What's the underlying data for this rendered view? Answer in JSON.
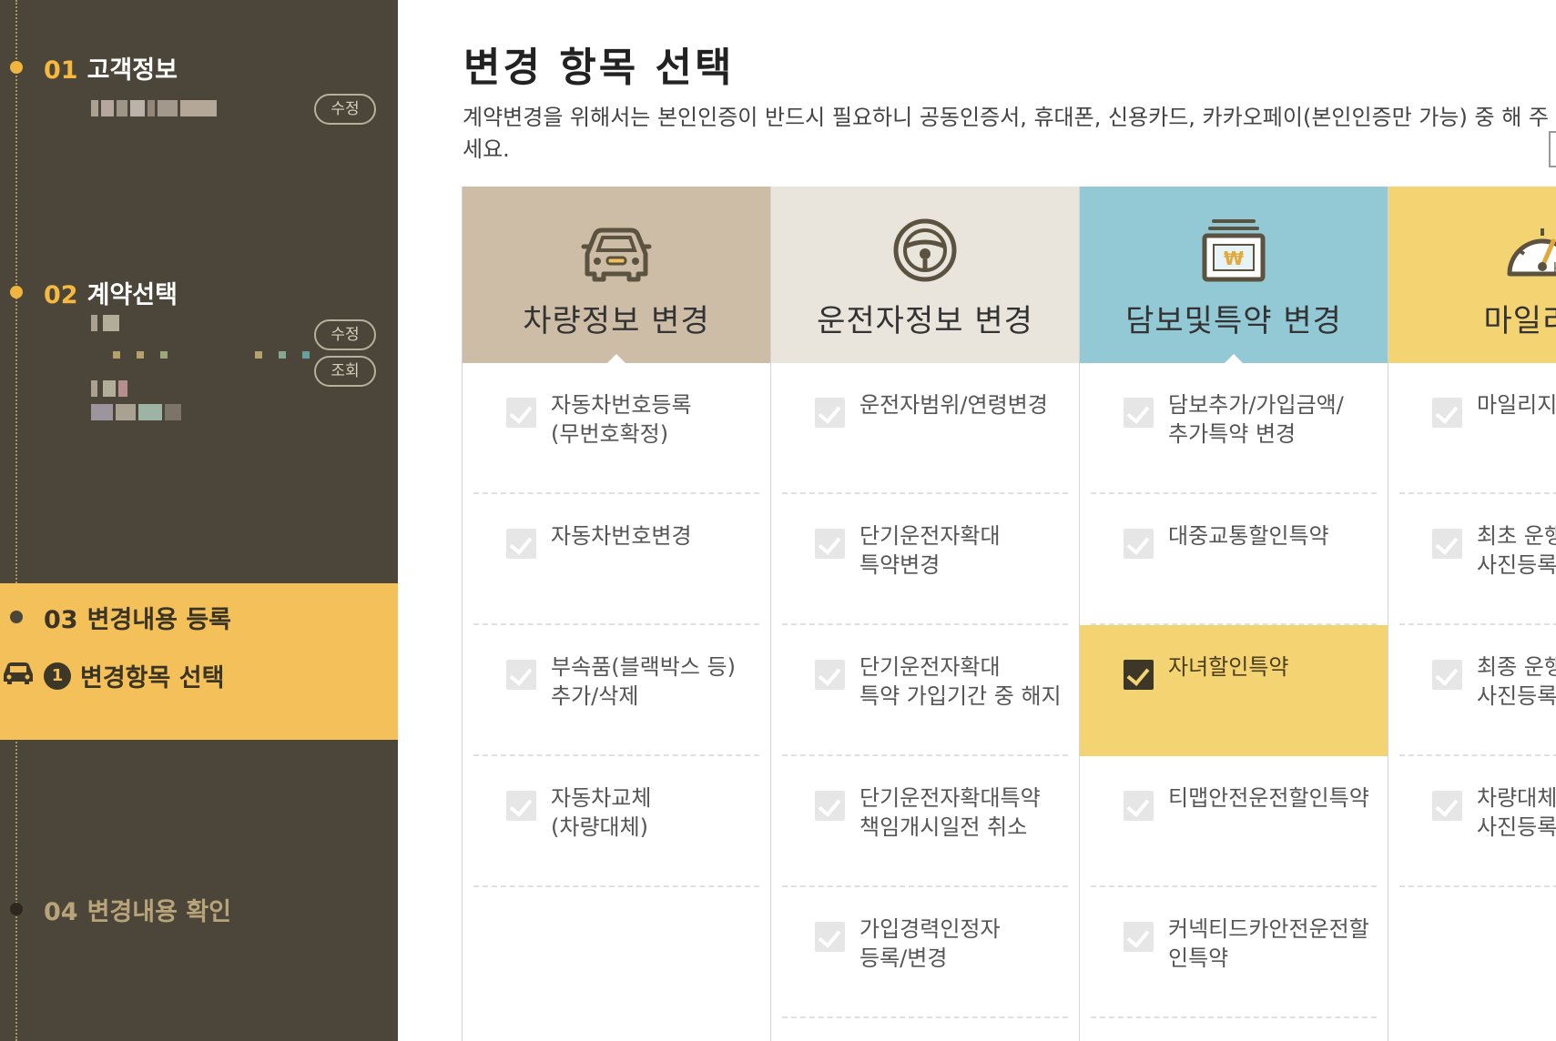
{
  "sidebar": {
    "steps": [
      {
        "num": "01",
        "label": "고객정보",
        "actions": [
          "수정"
        ]
      },
      {
        "num": "02",
        "label": "계약선택",
        "actions": [
          "수정",
          "조회"
        ]
      },
      {
        "num": "03",
        "label": "변경내용 등록",
        "sub": {
          "badge": "1",
          "label": "변경항목 선택"
        }
      },
      {
        "num": "04",
        "label": "변경내용 확인"
      }
    ]
  },
  "main": {
    "title": "변경 항목 선택",
    "description": "계약변경을 위해서는 본인인증이 반드시 필요하니 공동인증서, 휴대폰, 신용카드, 카카오페이(본인인증만 가능) 중 해 주세요.",
    "categories": [
      {
        "label": "차량정보 변경",
        "icon": "car-icon",
        "color": "#cdbda7",
        "items": [
          {
            "text": "자동차번호등록\n(무번호확정)",
            "checked": false
          },
          {
            "text": "자동차번호변경",
            "checked": false
          },
          {
            "text": "부속품(블랙박스 등)\n추가/삭제",
            "checked": false
          },
          {
            "text": "자동차교체\n(차량대체)",
            "checked": false
          }
        ]
      },
      {
        "label": "운전자정보 변경",
        "icon": "steering-wheel-icon",
        "color": "#e9e4dc",
        "items": [
          {
            "text": "운전자범위/연령변경",
            "checked": false
          },
          {
            "text": "단기운전자확대\n특약변경",
            "checked": false
          },
          {
            "text": "단기운전자확대\n특약 가입기간 중 해지",
            "checked": false
          },
          {
            "text": "단기운전자확대특약\n책임개시일전 취소",
            "checked": false
          },
          {
            "text": "가입경력인정자\n등록/변경",
            "checked": false
          }
        ]
      },
      {
        "label": "담보및특약 변경",
        "icon": "won-card-icon",
        "color": "#92c9d5",
        "items": [
          {
            "text": "담보추가/가입금액/\n추가특약 변경",
            "checked": false
          },
          {
            "text": "대중교통할인특약",
            "checked": false
          },
          {
            "text": "자녀할인특약",
            "checked": true
          },
          {
            "text": "티맵안전운전할인특약",
            "checked": false
          },
          {
            "text": "커넥티드카안전운전할\n인특약",
            "checked": false
          }
        ]
      },
      {
        "label": "마일리지",
        "icon": "speedometer-icon",
        "color": "#f3d372",
        "items": [
          {
            "text": "마일리지",
            "checked": false
          },
          {
            "text": "최초 운행\n사진등록",
            "checked": false
          },
          {
            "text": "최종 운행\n사진등록",
            "checked": false
          },
          {
            "text": "차량대체\n사진등록",
            "checked": false
          }
        ]
      }
    ]
  }
}
